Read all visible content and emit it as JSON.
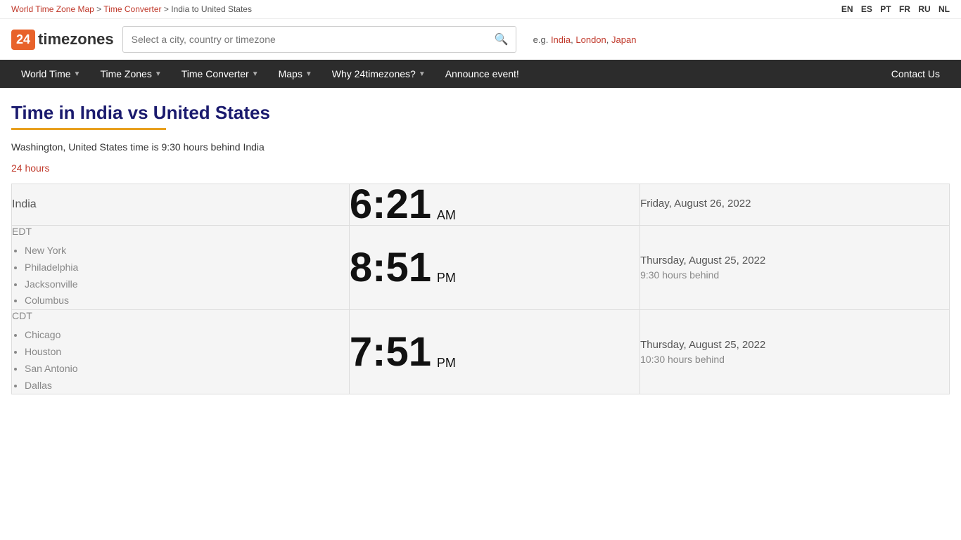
{
  "topbar": {
    "breadcrumb": [
      {
        "label": "World Time Zone Map",
        "href": "#",
        "link": true
      },
      {
        "sep": " > "
      },
      {
        "label": "Time Converter",
        "href": "#",
        "link": true
      },
      {
        "sep": " > "
      },
      {
        "label": "India to United States",
        "link": false
      }
    ],
    "languages": [
      "EN",
      "ES",
      "PT",
      "FR",
      "RU",
      "NL"
    ]
  },
  "header": {
    "logo_number": "24",
    "logo_text": "timezones",
    "search_placeholder": "Select a city, country or timezone",
    "examples_label": "e.g.",
    "examples": [
      "India",
      "London",
      "Japan"
    ]
  },
  "nav": {
    "items": [
      {
        "label": "World Time",
        "has_dropdown": true
      },
      {
        "label": "Time Zones",
        "has_dropdown": true
      },
      {
        "label": "Time Converter",
        "has_dropdown": true
      },
      {
        "label": "Maps",
        "has_dropdown": true
      },
      {
        "label": "Why 24timezones?",
        "has_dropdown": true
      },
      {
        "label": "Announce event!",
        "has_dropdown": false
      }
    ],
    "contact_label": "Contact Us"
  },
  "page": {
    "title": "Time in India vs United States",
    "subtitle": "Washington, United States time is 9:30 hours behind India",
    "link_24h": "24 hours"
  },
  "rows": [
    {
      "location_label": "India",
      "timezone": "",
      "cities": [],
      "time": "6:21",
      "ampm": "AM",
      "date": "Friday, August 26, 2022",
      "behind": ""
    },
    {
      "location_label": "EDT",
      "timezone": "EDT",
      "cities": [
        "New York",
        "Philadelphia",
        "Jacksonville",
        "Columbus"
      ],
      "time": "8:51",
      "ampm": "PM",
      "date": "Thursday, August 25, 2022",
      "behind": "9:30 hours behind"
    },
    {
      "location_label": "CDT",
      "timezone": "CDT",
      "cities": [
        "Chicago",
        "Houston",
        "San Antonio",
        "Dallas"
      ],
      "time": "7:51",
      "ampm": "PM",
      "date": "Thursday, August 25, 2022",
      "behind": "10:30 hours behind"
    }
  ]
}
